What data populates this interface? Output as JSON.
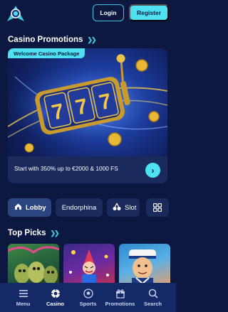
{
  "header": {
    "login_label": "Login",
    "register_label": "Register",
    "logo_icon": "astronaut-logo-icon"
  },
  "promotions": {
    "title": "Casino Promotions",
    "badge": "Welcome Casino Package",
    "offer_text": "Start with 350% up to €2000 & 1000 FS",
    "art_digits": [
      "7",
      "7",
      "7"
    ]
  },
  "tabs": [
    {
      "label": "Lobby",
      "icon": "home-icon",
      "active": true
    },
    {
      "label": "Endorphina",
      "active": false
    },
    {
      "label": "Slot",
      "icon": "cherries-icon",
      "active": false
    }
  ],
  "grid_button_icon": "grid-icon",
  "top_picks": {
    "title": "Top Picks"
  },
  "bottom_nav": [
    {
      "label": "Menu",
      "icon": "menu-icon"
    },
    {
      "label": "Casino",
      "icon": "casino-chip-icon",
      "active": true
    },
    {
      "label": "Sports",
      "icon": "soccer-ball-icon"
    },
    {
      "label": "Promotions",
      "icon": "gift-icon"
    },
    {
      "label": "Search",
      "icon": "search-icon"
    }
  ],
  "colors": {
    "background": "#0c1840",
    "accent": "#4fe0f2",
    "card": "#1a2a5c",
    "nav": "#142a66"
  }
}
